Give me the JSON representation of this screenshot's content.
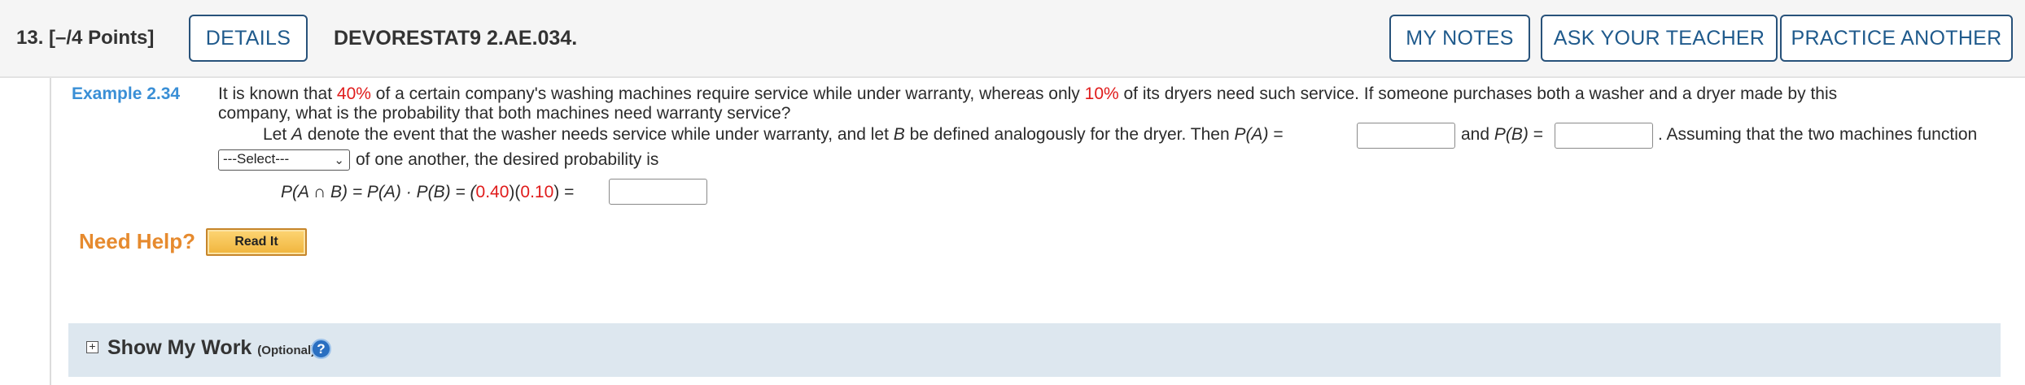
{
  "header": {
    "question_number": "13.",
    "points": "[–/4 Points]",
    "details_label": "DETAILS",
    "question_id": "DEVORESTAT9 2.AE.034.",
    "my_notes_label": "MY NOTES",
    "ask_teacher_label": "ASK YOUR TEACHER",
    "practice_label": "PRACTICE ANOTHER"
  },
  "problem": {
    "example_label": "Example 2.34",
    "line1_a": "It is known that ",
    "pct1": "40%",
    "line1_b": " of a certain company's washing machines require service while under warranty, whereas only ",
    "pct2": "10%",
    "line1_c": " of its dryers need such service. If someone purchases both a washer and a dryer made by this",
    "line2": "company, what is the probability that both machines need warranty service?",
    "line3_a": "Let ",
    "var_a": "A",
    "line3_b": " denote the event that the washer needs service while under warranty, and let ",
    "var_b": "B",
    "line3_c": " be defined analogously for the dryer. Then ",
    "pa_label": "P(A)",
    "eq": " =",
    "and_text": "and ",
    "pb_label": "P(B)",
    "eq2": " =",
    "line3_d": ". Assuming that the two machines function",
    "select_value": "---Select---",
    "line4": "of one another, the desired probability is",
    "formula_a": "P(A ∩ B) = P(A) · P(B) = (",
    "f_val1": "0.40",
    "formula_mid": ")(",
    "f_val2": "0.10",
    "formula_end": ") ="
  },
  "help": {
    "need_help_label": "Need Help?",
    "read_it_label": "Read It"
  },
  "show_my_work": {
    "title": "Show My Work",
    "optional": "(Optional)",
    "help_glyph": "?"
  },
  "colors": {
    "accent_blue": "#1f5a8c",
    "example_blue": "#3a8fd6",
    "red": "#e01b1b",
    "need_help_orange": "#e68a2e"
  }
}
